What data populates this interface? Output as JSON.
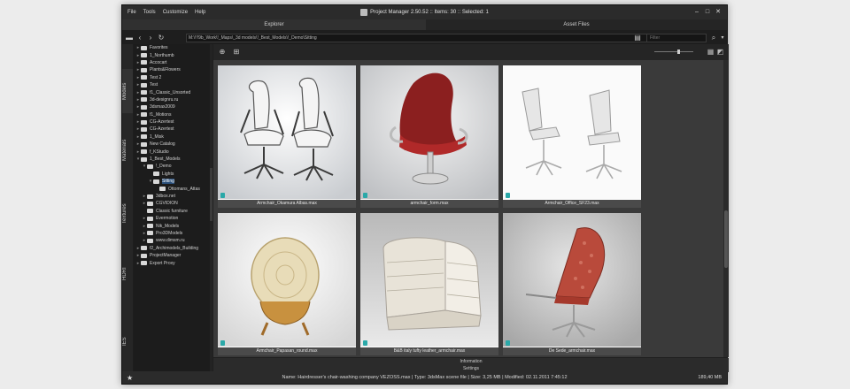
{
  "menu": [
    "File",
    "Tools",
    "Customize",
    "Help"
  ],
  "window_title": "Project Manager 2.50.52  ::  Items: 30  ::  Selected: 1",
  "tabs": [
    {
      "label": "Explorer"
    },
    {
      "label": "Asset Files"
    }
  ],
  "path": "M:\\!!!9b_Work\\!_Maps\\_3d models\\!_Best_Models\\!_Demo\\Sitting",
  "filter_placeholder": "Filter",
  "side_tabs": [
    "Models",
    "Materials",
    "Textures",
    "HDRI",
    "IES"
  ],
  "tree": [
    {
      "label": "Favorites",
      "depth": 0,
      "arrow": "▸"
    },
    {
      "label": "1_Northumb",
      "depth": 0,
      "arrow": "▸"
    },
    {
      "label": "Accocart",
      "depth": 0,
      "arrow": "▸"
    },
    {
      "label": "Plants&Flowers",
      "depth": 0,
      "arrow": "▸"
    },
    {
      "label": "Test 2",
      "depth": 0,
      "arrow": "▸"
    },
    {
      "label": "Test",
      "depth": 0,
      "arrow": "▸"
    },
    {
      "label": "f1_Classic_Unsorted",
      "depth": 0,
      "arrow": "▸"
    },
    {
      "label": "3d-designru.ru",
      "depth": 0,
      "arrow": "▸"
    },
    {
      "label": "3dsmax2009",
      "depth": 0,
      "arrow": "▸"
    },
    {
      "label": "f1_Motions",
      "depth": 0,
      "arrow": "▸"
    },
    {
      "label": "CG-Azertest",
      "depth": 0,
      "arrow": "▸"
    },
    {
      "label": "CG-Azertest",
      "depth": 0,
      "arrow": "▸"
    },
    {
      "label": "1_Misk",
      "depth": 0,
      "arrow": "▸"
    },
    {
      "label": "New Catalog",
      "depth": 0,
      "arrow": "▸"
    },
    {
      "label": "f_KStudio",
      "depth": 0,
      "arrow": "▸"
    },
    {
      "label": "1_Best_Models",
      "depth": 0,
      "arrow": "▾"
    },
    {
      "label": "!_Demo",
      "depth": 1,
      "arrow": "▾"
    },
    {
      "label": "Lights",
      "depth": 2,
      "arrow": ""
    },
    {
      "label": "Sitting",
      "depth": 2,
      "arrow": "▾",
      "selected": true
    },
    {
      "label": "Ottomans_Attas",
      "depth": 3,
      "arrow": ""
    },
    {
      "label": "3dbox.net",
      "depth": 1,
      "arrow": "▸"
    },
    {
      "label": "CGVIDION",
      "depth": 1,
      "arrow": "▸"
    },
    {
      "label": "Classic furniture",
      "depth": 1,
      "arrow": ""
    },
    {
      "label": "Evermotion",
      "depth": 1,
      "arrow": "▸"
    },
    {
      "label": "Nik_Models",
      "depth": 1,
      "arrow": "▸"
    },
    {
      "label": "Pro3DModels",
      "depth": 1,
      "arrow": "▸"
    },
    {
      "label": "www.dimsm.ru",
      "depth": 1,
      "arrow": "▸"
    },
    {
      "label": "f2_Archimodels_Building",
      "depth": 0,
      "arrow": "▸"
    },
    {
      "label": "ProjectManager",
      "depth": 0,
      "arrow": "▸"
    },
    {
      "label": "Export Proxy",
      "depth": 0,
      "arrow": "▸"
    }
  ],
  "cards": [
    {
      "caption": "Armchair_Okamura Albas.max",
      "art": "office-pair"
    },
    {
      "caption": "armchair_form.max",
      "art": "red-lounge"
    },
    {
      "caption": "Armchair_Office_SF23.max",
      "art": "mesh-pair"
    },
    {
      "caption": "Armchair_Papasan_round.max",
      "art": "papasan"
    },
    {
      "caption": "B&B italy tufty leather_armchair.max",
      "art": "tufty"
    },
    {
      "caption": "De Sede_armchair.max",
      "art": "desede"
    }
  ],
  "bottom_panels": [
    "Information",
    "Settings"
  ],
  "status": "Name: Hairdresser's chair-washing company VEZOSS.max | Type: 3dsMax scene file | Size: 3,25 MB | Modified: 02.11.2011 7:45:12",
  "status_size": "189,40 MB",
  "colors": {
    "accent": "#2a4f7a",
    "badge": "#2aa8a8",
    "chrome": "#1e1e1e"
  }
}
